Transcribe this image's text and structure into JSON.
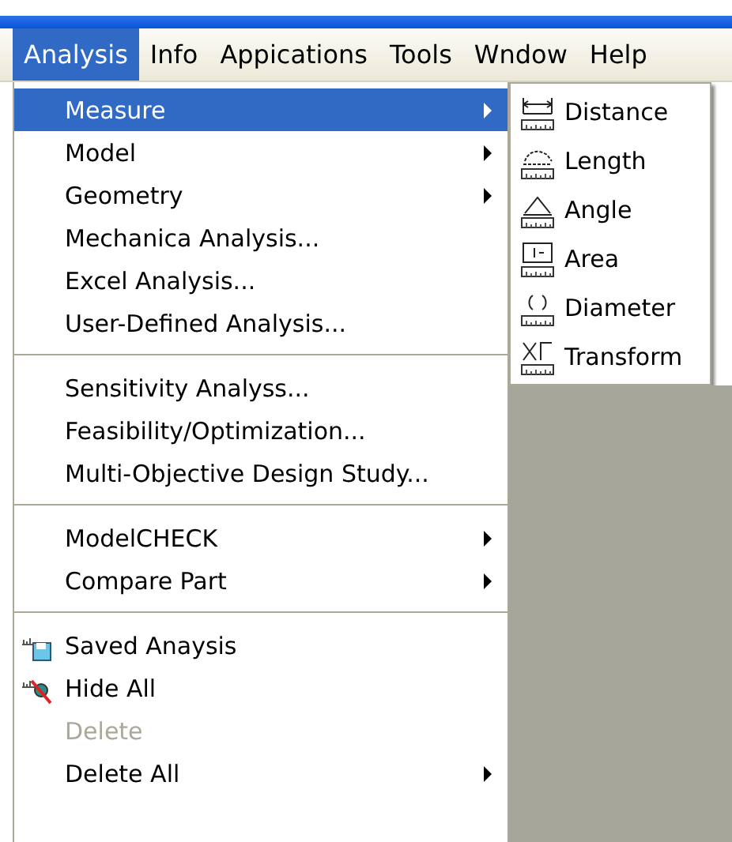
{
  "menu_bar": [
    {
      "label": "Analysis",
      "selected": true
    },
    {
      "label": "Info",
      "selected": false
    },
    {
      "label": "Appications",
      "selected": false
    },
    {
      "label": "Tools",
      "selected": false
    },
    {
      "label": "Wndow",
      "selected": false
    },
    {
      "label": "Help",
      "selected": false
    }
  ],
  "analysis_menu": {
    "sections": [
      [
        {
          "label": "Measure",
          "kind": "submenu",
          "selected": true,
          "disabled": false
        },
        {
          "label": "Model",
          "kind": "submenu",
          "selected": false,
          "disabled": false
        },
        {
          "label": "Geometry",
          "kind": "submenu",
          "selected": false,
          "disabled": false
        },
        {
          "label": "Mechanica Analysis...",
          "kind": "command",
          "selected": false,
          "disabled": false
        },
        {
          "label": "Excel Analysis...",
          "kind": "command",
          "selected": false,
          "disabled": false
        },
        {
          "label": "User-Defined Analysis...",
          "kind": "command",
          "selected": false,
          "disabled": false
        }
      ],
      [
        {
          "label": "Sensitivity Analyss...",
          "kind": "command",
          "selected": false,
          "disabled": false
        },
        {
          "label": "Feasibility/Optimization...",
          "kind": "command",
          "selected": false,
          "disabled": false
        },
        {
          "label": "Multi-Objective Design Study...",
          "kind": "command",
          "selected": false,
          "disabled": false
        }
      ],
      [
        {
          "label": "ModelCHECK",
          "kind": "submenu",
          "selected": false,
          "disabled": false
        },
        {
          "label": "Compare Part",
          "kind": "submenu",
          "selected": false,
          "disabled": false
        }
      ],
      [
        {
          "label": "Saved Anaysis",
          "kind": "icon",
          "selected": false,
          "disabled": false
        },
        {
          "label": "Hide All",
          "kind": "icon",
          "selected": false,
          "disabled": false
        },
        {
          "label": "Delete",
          "kind": "command",
          "selected": false,
          "disabled": true
        },
        {
          "label": "Delete All",
          "kind": "submenu",
          "selected": false,
          "disabled": false
        }
      ]
    ]
  },
  "measure_submenu": [
    {
      "label": "Distance",
      "selected": false
    },
    {
      "label": "Length",
      "selected": false
    },
    {
      "label": "Angle",
      "selected": false
    },
    {
      "label": "Area",
      "selected": false
    },
    {
      "label": "Diameter",
      "selected": false
    },
    {
      "label": "Transform",
      "selected": false
    }
  ]
}
